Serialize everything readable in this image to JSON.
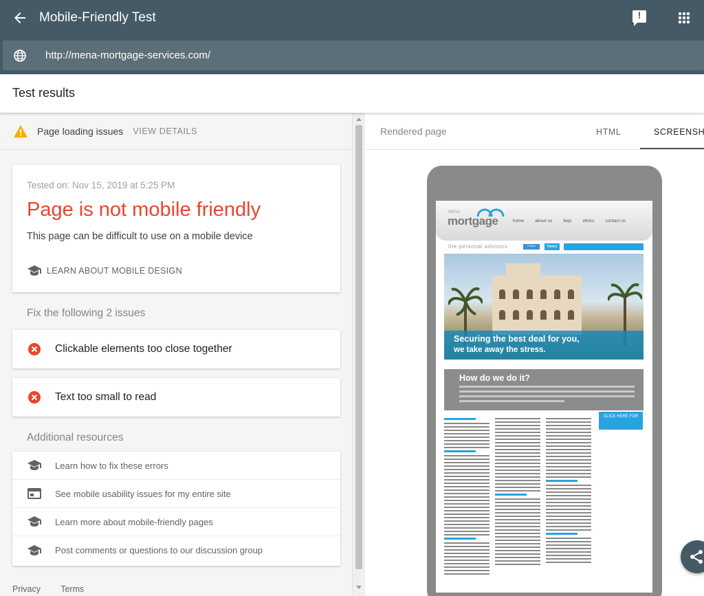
{
  "topbar": {
    "title": "Mobile-Friendly Test",
    "url": "http://mena-mortgage-services.com/"
  },
  "results_header": "Test results",
  "issues_strip": {
    "text": "Page loading issues",
    "action": "VIEW DETAILS"
  },
  "main_card": {
    "tested_on": "Tested on: Nov 15, 2019 at 5:25 PM",
    "verdict": "Page is not mobile friendly",
    "subtitle": "This page can be difficult to use on a mobile device",
    "learn_link": "LEARN ABOUT MOBILE DESIGN"
  },
  "fix_title": "Fix the following 2 issues",
  "issues": [
    "Clickable elements too close together",
    "Text too small to read"
  ],
  "resources_title": "Additional resources",
  "resources": [
    {
      "label": "Learn how to fix these errors",
      "icon": "graduation-cap-icon"
    },
    {
      "label": "See mobile usability issues for my entire site",
      "icon": "web-asset-icon"
    },
    {
      "label": "Learn more about mobile-friendly pages",
      "icon": "graduation-cap-icon"
    },
    {
      "label": "Post comments or questions to our discussion group",
      "icon": "graduation-cap-icon"
    }
  ],
  "footer": {
    "privacy": "Privacy",
    "terms": "Terms"
  },
  "right_panel": {
    "rendered_label": "Rendered page",
    "tab_html": "HTML",
    "tab_screenshot": "SCREENSHOT"
  },
  "preview": {
    "logo_small": "MENA",
    "logo": "mortgage",
    "nav": [
      "home",
      "about us",
      "faqs",
      "ethics",
      "contact us"
    ],
    "tagline": "the personal advisors",
    "twitter_label": "Follow",
    "news_label": "News",
    "hero_line1": "Securing the best deal for you,",
    "hero_line2": "we take away the stress.",
    "how_title": "How do we do it?",
    "click_here": "CLICK HERE FOR"
  },
  "colors": {
    "header_bg": "#455a64",
    "error_red": "#e8462b",
    "accent_blue": "#29a3e0"
  }
}
